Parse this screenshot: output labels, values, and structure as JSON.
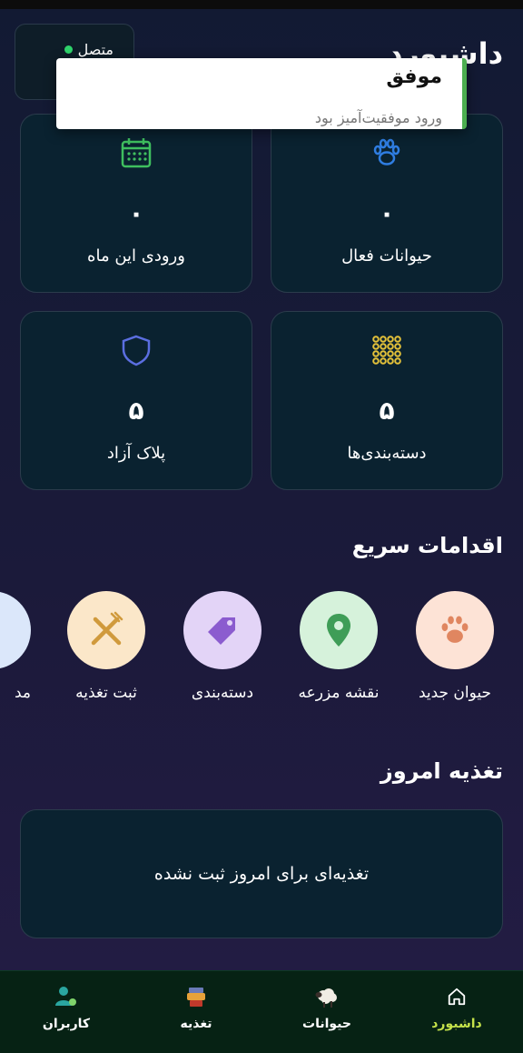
{
  "header": {
    "title": "داشبورد",
    "status_label": "متصل",
    "status_color": "#2fd36b"
  },
  "toast": {
    "title": "موفق",
    "message": "ورود موفقیت‌آمیز بود",
    "accent": "#4caf50"
  },
  "stats": [
    {
      "label": "حیوانات فعال",
      "value": "۰",
      "icon": "paw-icon",
      "color": "#2f7de1"
    },
    {
      "label": "ورودی این ماه",
      "value": "۰",
      "icon": "calendar-icon",
      "color": "#3fbf5f"
    },
    {
      "label": "دسته‌بندی‌ها",
      "value": "۵",
      "icon": "grid-dots-icon",
      "color": "#e3c13a"
    },
    {
      "label": "پلاک آزاد",
      "value": "۵",
      "icon": "shield-icon",
      "color": "#5b6ee0"
    }
  ],
  "quick_actions": {
    "title": "اقدامات سریع",
    "items": [
      {
        "label": "حیوان جدید",
        "icon": "paw-icon",
        "bg": "#fde3d6",
        "color": "#e08660"
      },
      {
        "label": "نقشه مزرعه",
        "icon": "map-pin-icon",
        "bg": "#d6f2db",
        "color": "#3f9d57"
      },
      {
        "label": "دسته‌بندی",
        "icon": "tag-icon",
        "bg": "#e3d4f7",
        "color": "#8b5ccf"
      },
      {
        "label": "ثبت تغذیه",
        "icon": "fork-knife-icon",
        "bg": "#fbe7c9",
        "color": "#d09a3c"
      },
      {
        "label": "مد",
        "icon": "partial-icon",
        "bg": "#dbe7fa",
        "color": "#5b8de0"
      }
    ]
  },
  "feeding": {
    "title": "تغذیه امروز",
    "empty_text": "تغذیه‌ای برای امروز ثبت نشده"
  },
  "nav": {
    "items": [
      {
        "label": "داشبورد",
        "icon": "home-icon",
        "active": true
      },
      {
        "label": "حیوانات",
        "icon": "sheep-icon",
        "active": false
      },
      {
        "label": "تغذیه",
        "icon": "feeding-icon",
        "active": false
      },
      {
        "label": "کاربران",
        "icon": "users-icon",
        "active": false
      }
    ],
    "active_color": "#c6e34a"
  }
}
